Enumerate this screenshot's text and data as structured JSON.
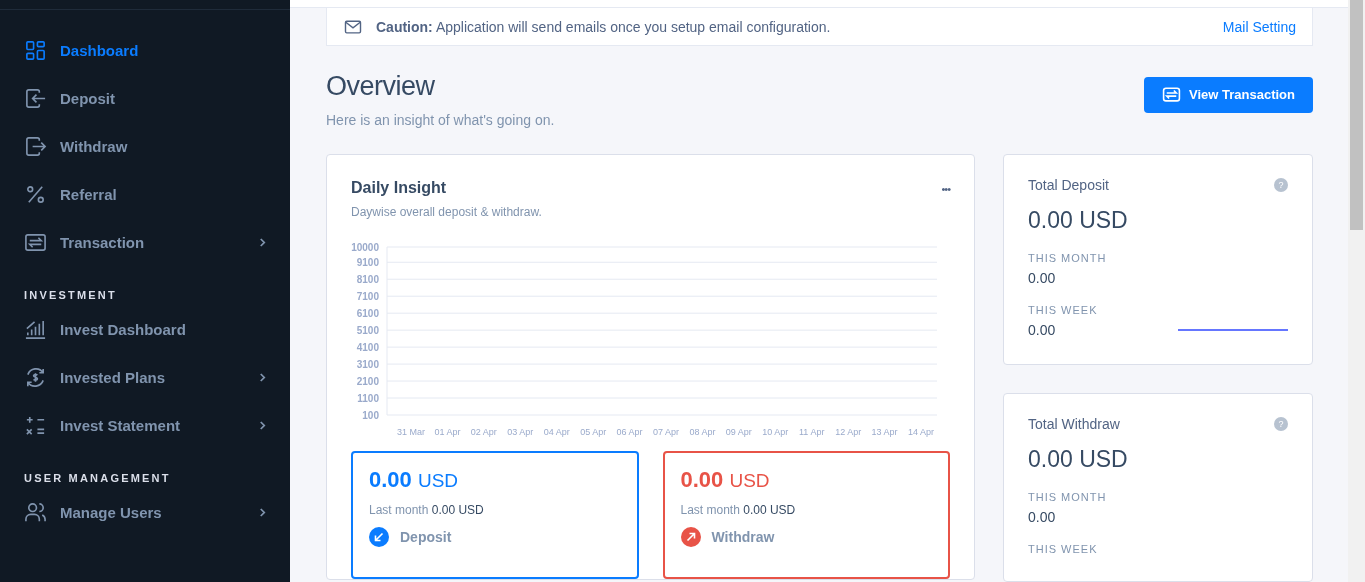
{
  "sidebar": {
    "sections": [
      {
        "items": [
          {
            "label": "Dashboard",
            "selected": true,
            "expandable": false
          },
          {
            "label": "Deposit",
            "selected": false,
            "expandable": false
          },
          {
            "label": "Withdraw",
            "selected": false,
            "expandable": false
          },
          {
            "label": "Referral",
            "selected": false,
            "expandable": false
          },
          {
            "label": "Transaction",
            "selected": false,
            "expandable": true
          }
        ]
      },
      {
        "heading": "INVESTMENT",
        "items": [
          {
            "label": "Invest Dashboard",
            "selected": false,
            "expandable": false
          },
          {
            "label": "Invested Plans",
            "selected": false,
            "expandable": true
          },
          {
            "label": "Invest Statement",
            "selected": false,
            "expandable": true
          }
        ]
      },
      {
        "heading": "USER MANAGEMENT",
        "items": [
          {
            "label": "Manage Users",
            "selected": false,
            "expandable": true
          }
        ]
      }
    ]
  },
  "alert": {
    "text": "**Caution:** Application will send emails once you setup email configuration.",
    "link": "Mail Setting"
  },
  "page": {
    "title": "Overview",
    "subtitle": "Here is an insight of what's going on.",
    "button": "View Transaction"
  },
  "insight": {
    "title": "Daily Insight",
    "subtitle": "Daywise overall deposit & withdraw.",
    "menu": "•••",
    "chart_data": {
      "type": "line",
      "categories": [
        "31 Mar",
        "01 Apr",
        "02 Apr",
        "03 Apr",
        "04 Apr",
        "05 Apr",
        "06 Apr",
        "07 Apr",
        "08 Apr",
        "09 Apr",
        "10 Apr",
        "11 Apr",
        "12 Apr",
        "13 Apr",
        "14 Apr"
      ],
      "ylim": [
        100,
        10000
      ],
      "grid": true,
      "yticks": [
        100,
        1100,
        2100,
        3100,
        4100,
        5100,
        6100,
        7100,
        8100,
        9100,
        10000
      ]
    },
    "summaries": [
      {
        "amount": "0.00",
        "currency": "USD",
        "last_label": "Last month",
        "last_value": "0.00 USD",
        "label": "Deposit",
        "color": "#0a7cff"
      },
      {
        "amount": "0.00",
        "currency": "USD",
        "last_label": "Last month",
        "last_value": "0.00 USD",
        "label": "Withdraw",
        "color": "#e85347"
      }
    ]
  },
  "totals": [
    {
      "title": "Total Deposit",
      "help": "?",
      "amount": "0.00 USD",
      "stats": [
        {
          "label": "THIS MONTH",
          "value": "0.00"
        },
        {
          "label": "THIS WEEK",
          "value": "0.00"
        }
      ],
      "sparkline": true
    },
    {
      "title": "Total Withdraw",
      "help": "?",
      "amount": "0.00 USD",
      "stats": [
        {
          "label": "THIS MONTH",
          "value": "0.00"
        },
        {
          "label": "THIS WEEK"
        }
      ],
      "sparkline": false
    }
  ]
}
